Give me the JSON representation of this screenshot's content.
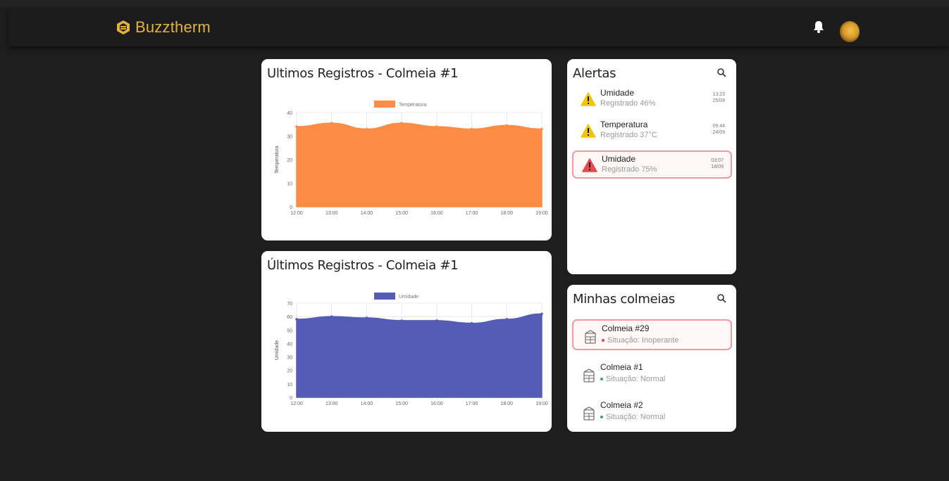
{
  "app": {
    "brand": "Buzztherm",
    "brand_color": "#e3b43a"
  },
  "header": {
    "icons": [
      "bell-icon",
      "avatar"
    ]
  },
  "cards": {
    "temperature": {
      "title": "Ultimos Registros - Colmeia #1"
    },
    "humidity": {
      "title": "Últimos Registros - Colmeia #1"
    },
    "alerts": {
      "title": "Alertas",
      "items": [
        {
          "title": "Umidade",
          "subtitle": "Registrado 46%",
          "time": "13:23",
          "date": "25/09",
          "level": "warning",
          "icon": "warning-icon"
        },
        {
          "title": "Temperatura",
          "subtitle": "Registrado 37°C",
          "time": "09:44",
          "date": "24/09",
          "level": "warning",
          "icon": "warning-icon"
        },
        {
          "title": "Umidade",
          "subtitle": "Registrado 75%",
          "time": "03:07",
          "date": "18/09",
          "level": "danger",
          "icon": "warning-icon"
        }
      ]
    },
    "hives": {
      "title": "Minhas colmeias",
      "items": [
        {
          "title": "Colmeia #29",
          "status": "Situação: Inoperante",
          "status_color": "#e04848",
          "icon": "beehive-icon"
        },
        {
          "title": "Colmeia #1",
          "status": "Situação: Normal",
          "status_color": "#3aa55a",
          "icon": "beehive-icon"
        },
        {
          "title": "Colmeia #2",
          "status": "Situação: Normal",
          "status_color": "#3aa55a",
          "icon": "beehive-icon"
        }
      ]
    }
  },
  "chart_data": [
    {
      "type": "area",
      "legend": "Temperatura",
      "ylabel": "Temperatura",
      "color": "#fb8c45",
      "x": [
        "12:00",
        "13:00",
        "14:00",
        "15:00",
        "16:00",
        "17:00",
        "18:00",
        "19:00"
      ],
      "values": [
        34,
        35.5,
        33,
        35.5,
        34,
        33,
        34.5,
        33
      ],
      "ylim": [
        0,
        40
      ],
      "yticks": [
        0,
        10,
        20,
        30,
        40
      ]
    },
    {
      "type": "area",
      "legend": "Umidade",
      "ylabel": "Umidade",
      "color": "#545cb5",
      "x": [
        "12:00",
        "13:00",
        "14:00",
        "15:00",
        "16:00",
        "17:00",
        "18:00",
        "19:00"
      ],
      "values": [
        58,
        60,
        59,
        57,
        57,
        55,
        58,
        62
      ],
      "ylim": [
        0,
        70
      ],
      "yticks": [
        0,
        10,
        20,
        30,
        40,
        50,
        60,
        70
      ]
    }
  ]
}
